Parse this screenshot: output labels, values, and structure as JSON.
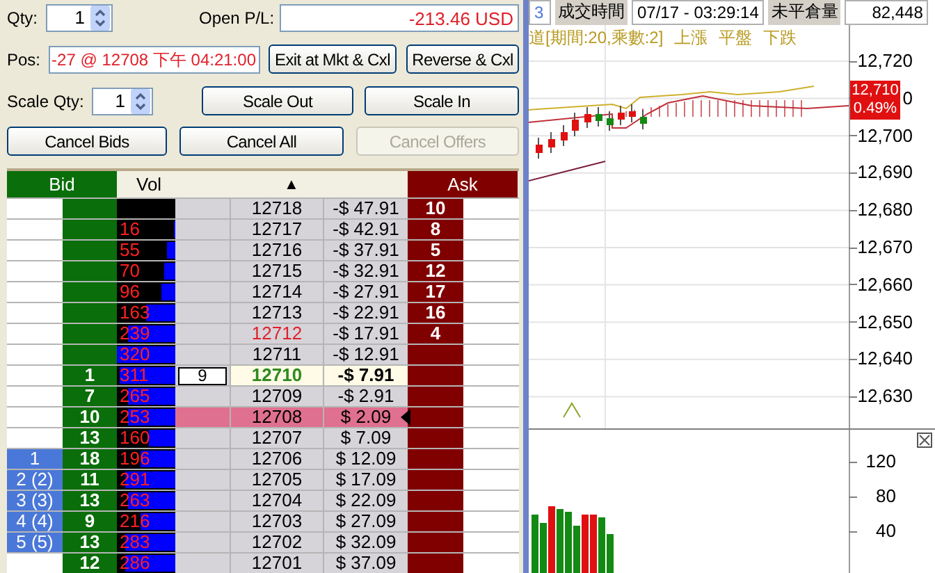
{
  "order_entry": {
    "qty_label": "Qty:",
    "qty": "1",
    "open_pl_label": "Open P/L:",
    "open_pl": "-213.46 USD",
    "pos_label": "Pos:",
    "pos": "-27 @ 12708 下午 04:21:00",
    "scale_qty_label": "Scale Qty:",
    "scale_qty": "1"
  },
  "buttons": [
    {
      "label": "Exit at Mkt & Cxl",
      "disabled": false
    },
    {
      "label": "Reverse & Cxl",
      "disabled": false
    },
    {
      "label": "Scale Out",
      "disabled": false
    },
    {
      "label": "Scale In",
      "disabled": false
    },
    {
      "label": "Cancel Bids",
      "disabled": false
    },
    {
      "label": "Cancel All",
      "disabled": false
    },
    {
      "label": "Cancel Offers",
      "disabled": true
    }
  ],
  "ladder": {
    "columns": [
      {
        "label": "Bid"
      },
      {
        "label": "Vol"
      },
      {
        "label": "▲"
      },
      {
        "label": "Ask"
      }
    ],
    "rows": [
      {
        "kind": "normal",
        "orders": "",
        "bid": "",
        "volume": "",
        "my_order": "",
        "price": "12718",
        "pl": "-$ 47.91",
        "ask": "10"
      },
      {
        "kind": "normal",
        "orders": "",
        "bid": "",
        "volume": "16",
        "level": 0.03,
        "my_order": "",
        "price": "12717",
        "pl": "-$ 42.91",
        "ask": "8"
      },
      {
        "kind": "normal",
        "orders": "",
        "bid": "",
        "volume": "55",
        "level": 0.15,
        "my_order": "",
        "price": "12716",
        "pl": "-$ 37.91",
        "ask": "5"
      },
      {
        "kind": "normal",
        "orders": "",
        "bid": "",
        "volume": "70",
        "level": 0.2,
        "my_order": "",
        "price": "12715",
        "pl": "-$ 32.91",
        "ask": "12"
      },
      {
        "kind": "normal",
        "orders": "",
        "bid": "",
        "volume": "96",
        "level": 0.25,
        "my_order": "",
        "price": "12714",
        "pl": "-$ 27.91",
        "ask": "17"
      },
      {
        "kind": "normal",
        "orders": "",
        "bid": "",
        "volume": "163",
        "level": 0.5,
        "my_order": "",
        "price": "12713",
        "pl": "-$ 22.91",
        "ask": "16"
      },
      {
        "kind": "high",
        "orders": "",
        "bid": "",
        "volume": "239",
        "level": 0.8,
        "my_order": "",
        "price": "12712",
        "pl": "-$ 17.91",
        "ask": "4"
      },
      {
        "kind": "normal",
        "orders": "",
        "bid": "",
        "volume": "320",
        "level": 1,
        "my_order": "",
        "price": "12711",
        "pl": "-$ 12.91",
        "ask": ""
      },
      {
        "kind": "last",
        "orders": "",
        "bid": "1",
        "volume": "311",
        "level": 0.95,
        "my_order": "9",
        "price": "12710",
        "pl": "-$ 7.91",
        "ask": ""
      },
      {
        "kind": "normal",
        "orders": "",
        "bid": "7",
        "volume": "265",
        "level": 0.8,
        "my_order": "",
        "price": "12709",
        "pl": "-$ 2.91",
        "ask": ""
      },
      {
        "kind": "position",
        "orders": "",
        "bid": "10",
        "volume": "253",
        "level": 0.8,
        "my_order": "",
        "price": "12708",
        "pl": "$ 2.09",
        "ask": ""
      },
      {
        "kind": "normal",
        "orders": "",
        "bid": "13",
        "volume": "160",
        "level": 0.45,
        "my_order": "",
        "price": "12707",
        "pl": "$ 7.09",
        "ask": ""
      },
      {
        "kind": "normal",
        "orders": "1",
        "bid": "18",
        "volume": "196",
        "level": 0.6,
        "my_order": "",
        "price": "12706",
        "pl": "$ 12.09",
        "ask": ""
      },
      {
        "kind": "normal",
        "orders": "2 (2)",
        "bid": "11",
        "volume": "291",
        "level": 0.85,
        "my_order": "",
        "price": "12705",
        "pl": "$ 17.09",
        "ask": ""
      },
      {
        "kind": "normal",
        "orders": "3 (3)",
        "bid": "13",
        "volume": "263",
        "level": 0.8,
        "my_order": "",
        "price": "12704",
        "pl": "$ 22.09",
        "ask": ""
      },
      {
        "kind": "normal",
        "orders": "4 (4)",
        "bid": "9",
        "volume": "216",
        "level": 0.6,
        "my_order": "",
        "price": "12703",
        "pl": "$ 27.09",
        "ask": ""
      },
      {
        "kind": "normal",
        "orders": "5 (5)",
        "bid": "13",
        "volume": "283",
        "level": 0.85,
        "my_order": "",
        "price": "12702",
        "pl": "$ 32.09",
        "ask": ""
      },
      {
        "kind": "normal",
        "orders": "",
        "bid": "12",
        "volume": "286",
        "level": 0.85,
        "my_order": "",
        "price": "12701",
        "pl": "$ 37.09",
        "ask": ""
      }
    ]
  },
  "chart": {
    "header": [
      {
        "kind": "value",
        "text": "3"
      },
      {
        "kind": "label",
        "text": "成交時間"
      },
      {
        "kind": "value",
        "text": "07/17 - 03:29:14"
      },
      {
        "kind": "label",
        "text": "未平倉量"
      },
      {
        "kind": "value",
        "text": "82,448"
      }
    ],
    "legend": [
      "道[期間:20,乘數:2]",
      "上漲",
      "平盤",
      "下跌"
    ],
    "price_axis": [
      "12,720",
      "0",
      "12,700",
      "12,690",
      "12,680",
      "12,670",
      "12,660",
      "12,650",
      "12,640",
      "12,630"
    ],
    "last_price": {
      "price": "12,710",
      "change": "0.49%"
    },
    "volume_axis": [
      "120",
      "80",
      "40"
    ]
  }
}
